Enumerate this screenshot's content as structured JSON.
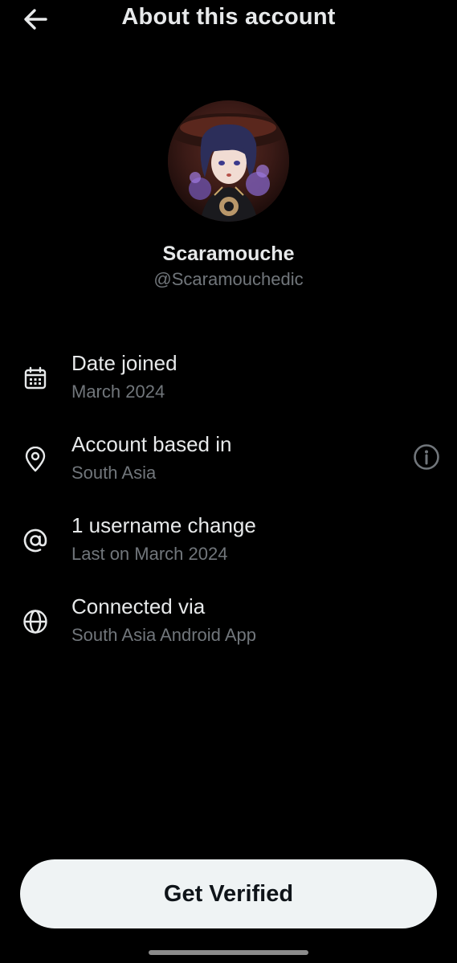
{
  "header": {
    "title": "About this account",
    "back_icon": "arrow-left-icon"
  },
  "profile": {
    "display_name": "Scaramouche",
    "handle": "@Scaramouchedic",
    "avatar": "avatar"
  },
  "details": [
    {
      "icon": "calendar-icon",
      "title": "Date joined",
      "subtitle": "March 2024"
    },
    {
      "icon": "location-pin-icon",
      "title": "Account based in",
      "subtitle": "South Asia",
      "action_icon": "info-icon"
    },
    {
      "icon": "at-sign-icon",
      "title": "1 username change",
      "subtitle": "Last on March 2024"
    },
    {
      "icon": "globe-icon",
      "title": "Connected via",
      "subtitle": "South Asia Android App"
    }
  ],
  "footer": {
    "button_label": "Get Verified"
  },
  "colors": {
    "background": "#000000",
    "primary_text": "#e7e9ea",
    "secondary_text": "#71767b",
    "button_bg": "#eff3f4",
    "button_text": "#0f1419"
  }
}
